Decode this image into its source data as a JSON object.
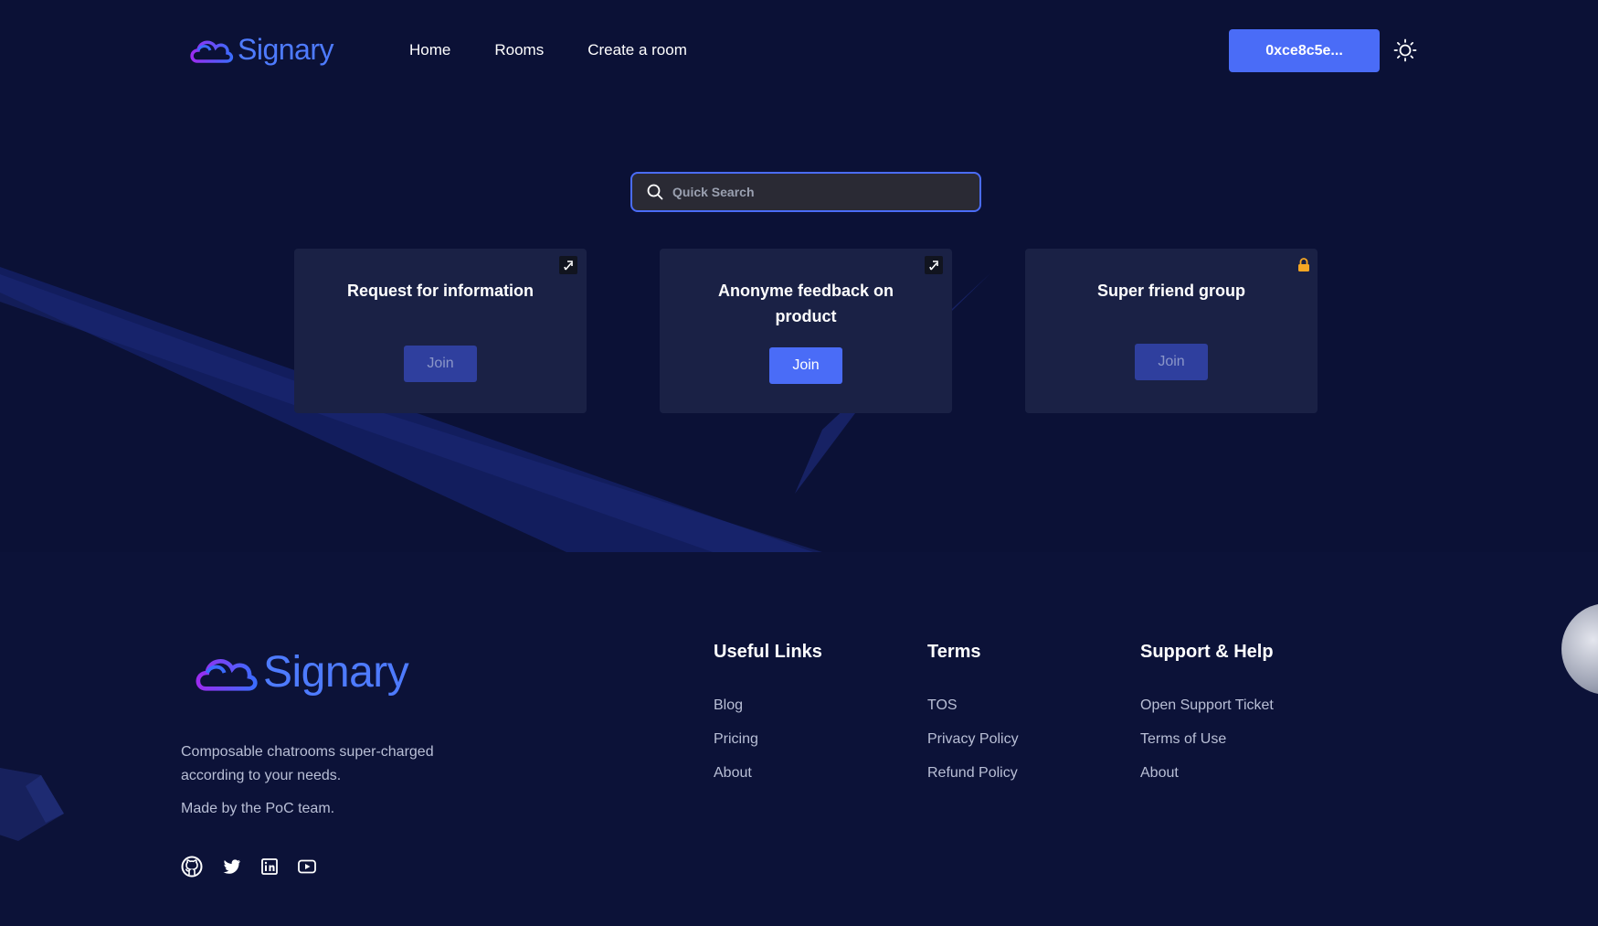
{
  "header": {
    "logo_text": "Signary",
    "nav": [
      "Home",
      "Rooms",
      "Create a room"
    ],
    "wallet_label": "0xce8c5e...",
    "theme_icon": "sun-icon"
  },
  "search": {
    "placeholder": "Quick Search",
    "value": ""
  },
  "rooms": [
    {
      "title": "Request for information",
      "join_label": "Join",
      "badge": "pin-icon",
      "join_style": "muted"
    },
    {
      "title": "Anonyme feedback on product",
      "join_label": "Join",
      "badge": "pin-icon",
      "join_style": "active"
    },
    {
      "title": "Super friend group",
      "join_label": "Join",
      "badge": "lock-icon",
      "join_style": "muted"
    }
  ],
  "footer": {
    "logo_text": "Signary",
    "tagline": "Composable chatrooms super-charged according to your needs.",
    "made_by": "Made by the PoC team.",
    "socials": [
      "github-icon",
      "twitter-icon",
      "linkedin-icon",
      "youtube-icon"
    ],
    "columns": [
      {
        "title": "Useful Links",
        "links": [
          "Blog",
          "Pricing",
          "About"
        ]
      },
      {
        "title": "Terms",
        "links": [
          "TOS",
          "Privacy Policy",
          "Refund Policy"
        ]
      },
      {
        "title": "Support & Help",
        "links": [
          "Open Support Ticket",
          "Terms of Use",
          "About"
        ]
      }
    ]
  },
  "colors": {
    "accent": "#4a6cf7",
    "background": "#0b1136",
    "card": "#1a2145",
    "lock": "#f5a623"
  }
}
